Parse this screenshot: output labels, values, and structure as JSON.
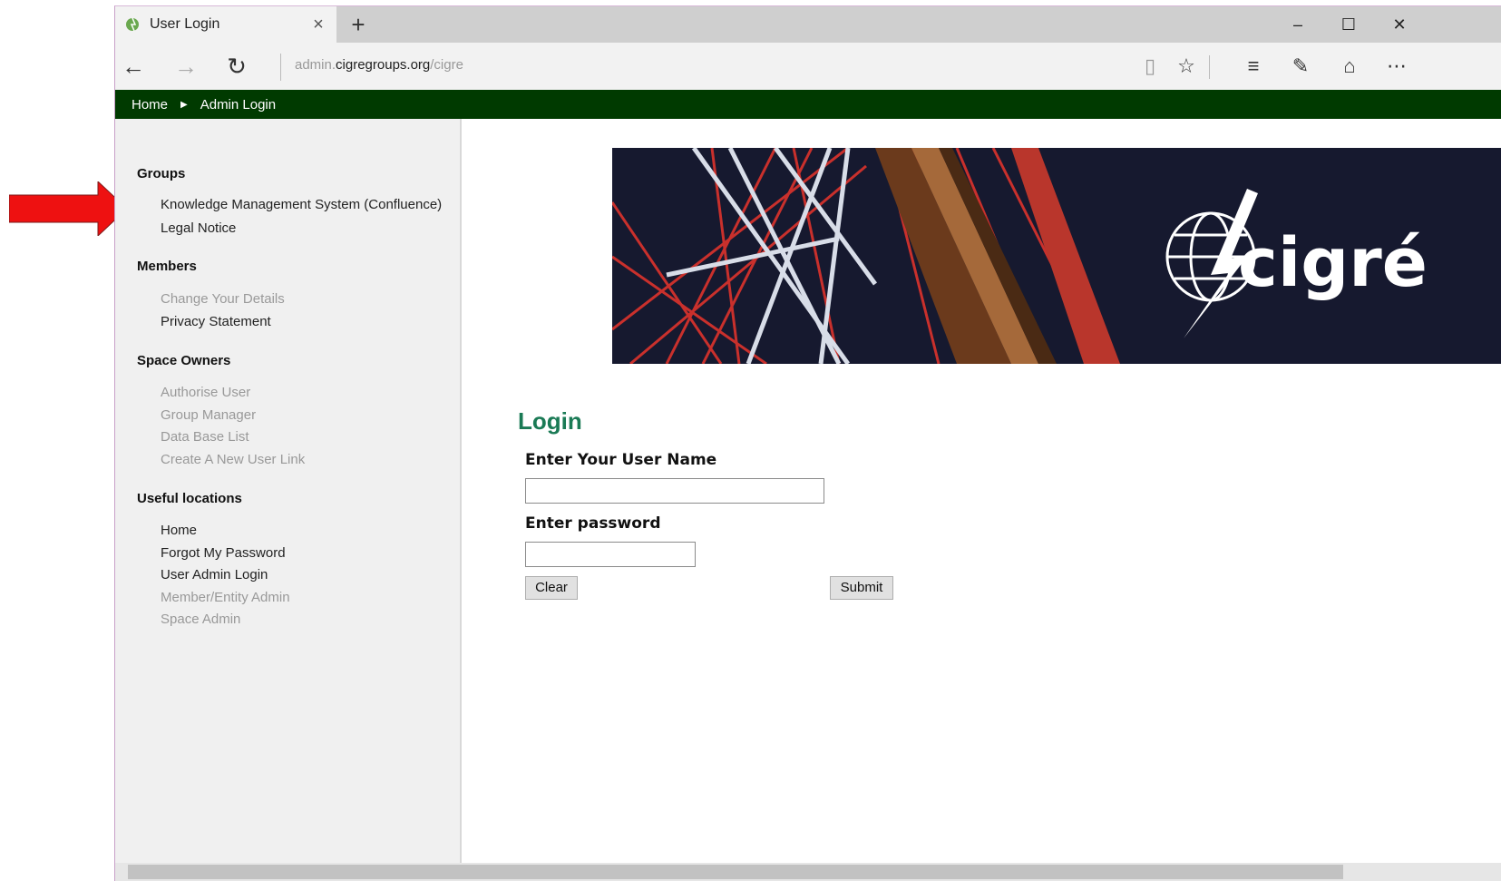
{
  "browser": {
    "tab_title": "User Login",
    "url_prefix": "admin.",
    "url_domain": "cigregroups.org",
    "url_path": "/cigre"
  },
  "breadcrumb": {
    "home": "Home",
    "current": "Admin Login"
  },
  "sidebar": {
    "groups": {
      "title": "Groups",
      "items": [
        "Knowledge Management System (Confluence)",
        "Legal Notice"
      ]
    },
    "members": {
      "title": "Members",
      "items": [
        "Change Your Details",
        "Privacy Statement"
      ]
    },
    "space_owners": {
      "title": "Space Owners",
      "items": [
        "Authorise User",
        "Group Manager",
        "Data Base List",
        "Create A New User Link"
      ]
    },
    "useful": {
      "title": "Useful locations",
      "items": [
        "Home",
        "Forgot My Password",
        "User Admin Login",
        "Member/Entity Admin",
        "Space Admin"
      ]
    }
  },
  "banner": {
    "logo_text": "cigré"
  },
  "login": {
    "title": "Login",
    "username_label": "Enter Your User Name",
    "username_value": "",
    "password_label": "Enter password",
    "password_value": "",
    "clear_label": "Clear",
    "submit_label": "Submit"
  },
  "colors": {
    "breadcrumb_bg": "#003a00",
    "login_title": "#1a7a55",
    "arrow": "#ee1111"
  }
}
